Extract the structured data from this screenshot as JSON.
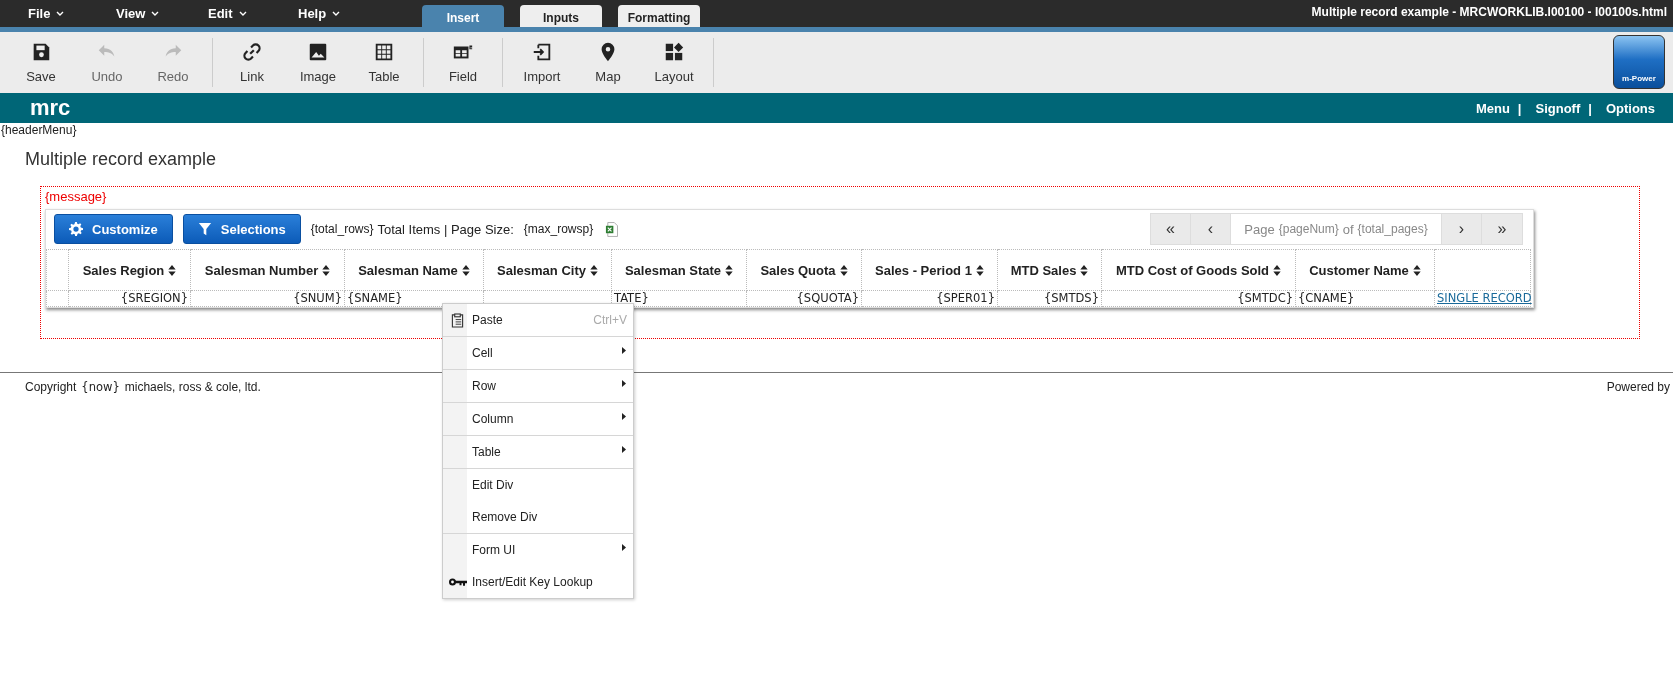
{
  "menubar": [
    {
      "label": "File"
    },
    {
      "label": "View"
    },
    {
      "label": "Edit"
    },
    {
      "label": "Help"
    }
  ],
  "ribbon_tabs": [
    {
      "label": "Insert",
      "selected": true
    },
    {
      "label": "Inputs",
      "selected": false
    },
    {
      "label": "Formatting",
      "selected": false
    }
  ],
  "window_title": "Multiple record example - MRCWORKLIB.I00100 - I00100s.html",
  "toolbar_groups": [
    [
      {
        "kind": "save",
        "label": "Save",
        "disabled": false
      },
      {
        "kind": "undo",
        "label": "Undo",
        "disabled": true
      },
      {
        "kind": "redo",
        "label": "Redo",
        "disabled": true
      }
    ],
    [
      {
        "kind": "link",
        "label": "Link",
        "disabled": false
      },
      {
        "kind": "image",
        "label": "Image",
        "disabled": false
      },
      {
        "kind": "table",
        "label": "Table",
        "disabled": false
      }
    ],
    [
      {
        "kind": "field",
        "label": "Field",
        "disabled": false
      }
    ],
    [
      {
        "kind": "import",
        "label": "Import",
        "disabled": false
      },
      {
        "kind": "map",
        "label": "Map",
        "disabled": false
      },
      {
        "kind": "layout",
        "label": "Layout",
        "disabled": false
      }
    ]
  ],
  "logo_text": "m-Power",
  "brand": "mrc",
  "nav_items": [
    {
      "kind": "link",
      "label": "Menu"
    },
    {
      "kind": "separator",
      "label": "|"
    },
    {
      "kind": "link",
      "label": "Signoff"
    },
    {
      "kind": "separator",
      "label": "|"
    },
    {
      "kind": "link",
      "label": "Options"
    }
  ],
  "header_menu": "{headerMenu}",
  "page_title": "Multiple record example",
  "message": "{message}",
  "grid_toolbar": {
    "buttons": [
      {
        "kind": "gear",
        "label": "Customize"
      },
      {
        "kind": "filter",
        "label": "Selections"
      }
    ],
    "total_rows": "{total_rows}",
    "summary": "Total Items | Page Size:",
    "page_size": "{max_rowsp}",
    "pager": {
      "first": "«",
      "prev": "‹",
      "page_label": "Page",
      "page_num": "{pageNum}",
      "of": "of",
      "total_pages": "{total_pages}",
      "next": "›",
      "last": "»"
    }
  },
  "table": {
    "columns": [
      {
        "label": "Sales Region",
        "sortable": true
      },
      {
        "label": "Salesman Number",
        "sortable": true
      },
      {
        "label": "Salesman Name",
        "sortable": true
      },
      {
        "label": "Salesman City",
        "sortable": true
      },
      {
        "label": "Salesman State",
        "sortable": true
      },
      {
        "label": "Sales Quota",
        "sortable": true
      },
      {
        "label": "Sales - Period 1",
        "sortable": true
      },
      {
        "label": "MTD Sales",
        "sortable": true
      },
      {
        "label": "MTD Cost of Goods Sold",
        "sortable": true
      },
      {
        "label": "Customer Name",
        "sortable": true
      },
      {
        "sortable": false
      }
    ],
    "row": [
      {
        "text": "{SREGION}",
        "right_aligned": true,
        "kind": "text"
      },
      {
        "text": "{SNUM}",
        "right_aligned": true,
        "kind": "text"
      },
      {
        "text": "{SNAME}",
        "right_aligned": false,
        "kind": "text"
      },
      {
        "kind": "covered"
      },
      {
        "text": "TATE}",
        "right_aligned": false,
        "kind": "partly_covered"
      },
      {
        "text": "{SQUOTA}",
        "right_aligned": true,
        "kind": "text"
      },
      {
        "text": "{SPER01}",
        "right_aligned": true,
        "kind": "text"
      },
      {
        "text": "{SMTDS}",
        "right_aligned": true,
        "kind": "text"
      },
      {
        "text": "{SMTDC}",
        "right_aligned": true,
        "kind": "text"
      },
      {
        "text": "{CNAME}",
        "right_aligned": false,
        "kind": "text"
      },
      {
        "text": "SINGLE RECORD",
        "kind": "link"
      }
    ]
  },
  "footer": {
    "copyright": "Copyright",
    "now": "{now}",
    "company": "michaels, ross & cole, ltd.",
    "powered_by": "Powered by"
  },
  "context_menu": [
    {
      "kind": "clipboard",
      "label": "Paste",
      "shortcut": "Ctrl+V",
      "divider_after": true
    },
    {
      "kind": "submenu",
      "label": "Cell",
      "divider_after": true
    },
    {
      "kind": "submenu",
      "label": "Row",
      "divider_after": true
    },
    {
      "kind": "submenu",
      "label": "Column",
      "divider_after": true
    },
    {
      "kind": "submenu",
      "label": "Table",
      "divider_after": true
    },
    {
      "kind": "action",
      "label": "Edit Div",
      "divider_after": false
    },
    {
      "kind": "action",
      "label": "Remove Div",
      "divider_after": true
    },
    {
      "kind": "submenu",
      "label": "Form UI",
      "divider_after": false
    },
    {
      "kind": "key",
      "label": "Insert/Edit Key Lookup",
      "divider_after": false
    }
  ]
}
